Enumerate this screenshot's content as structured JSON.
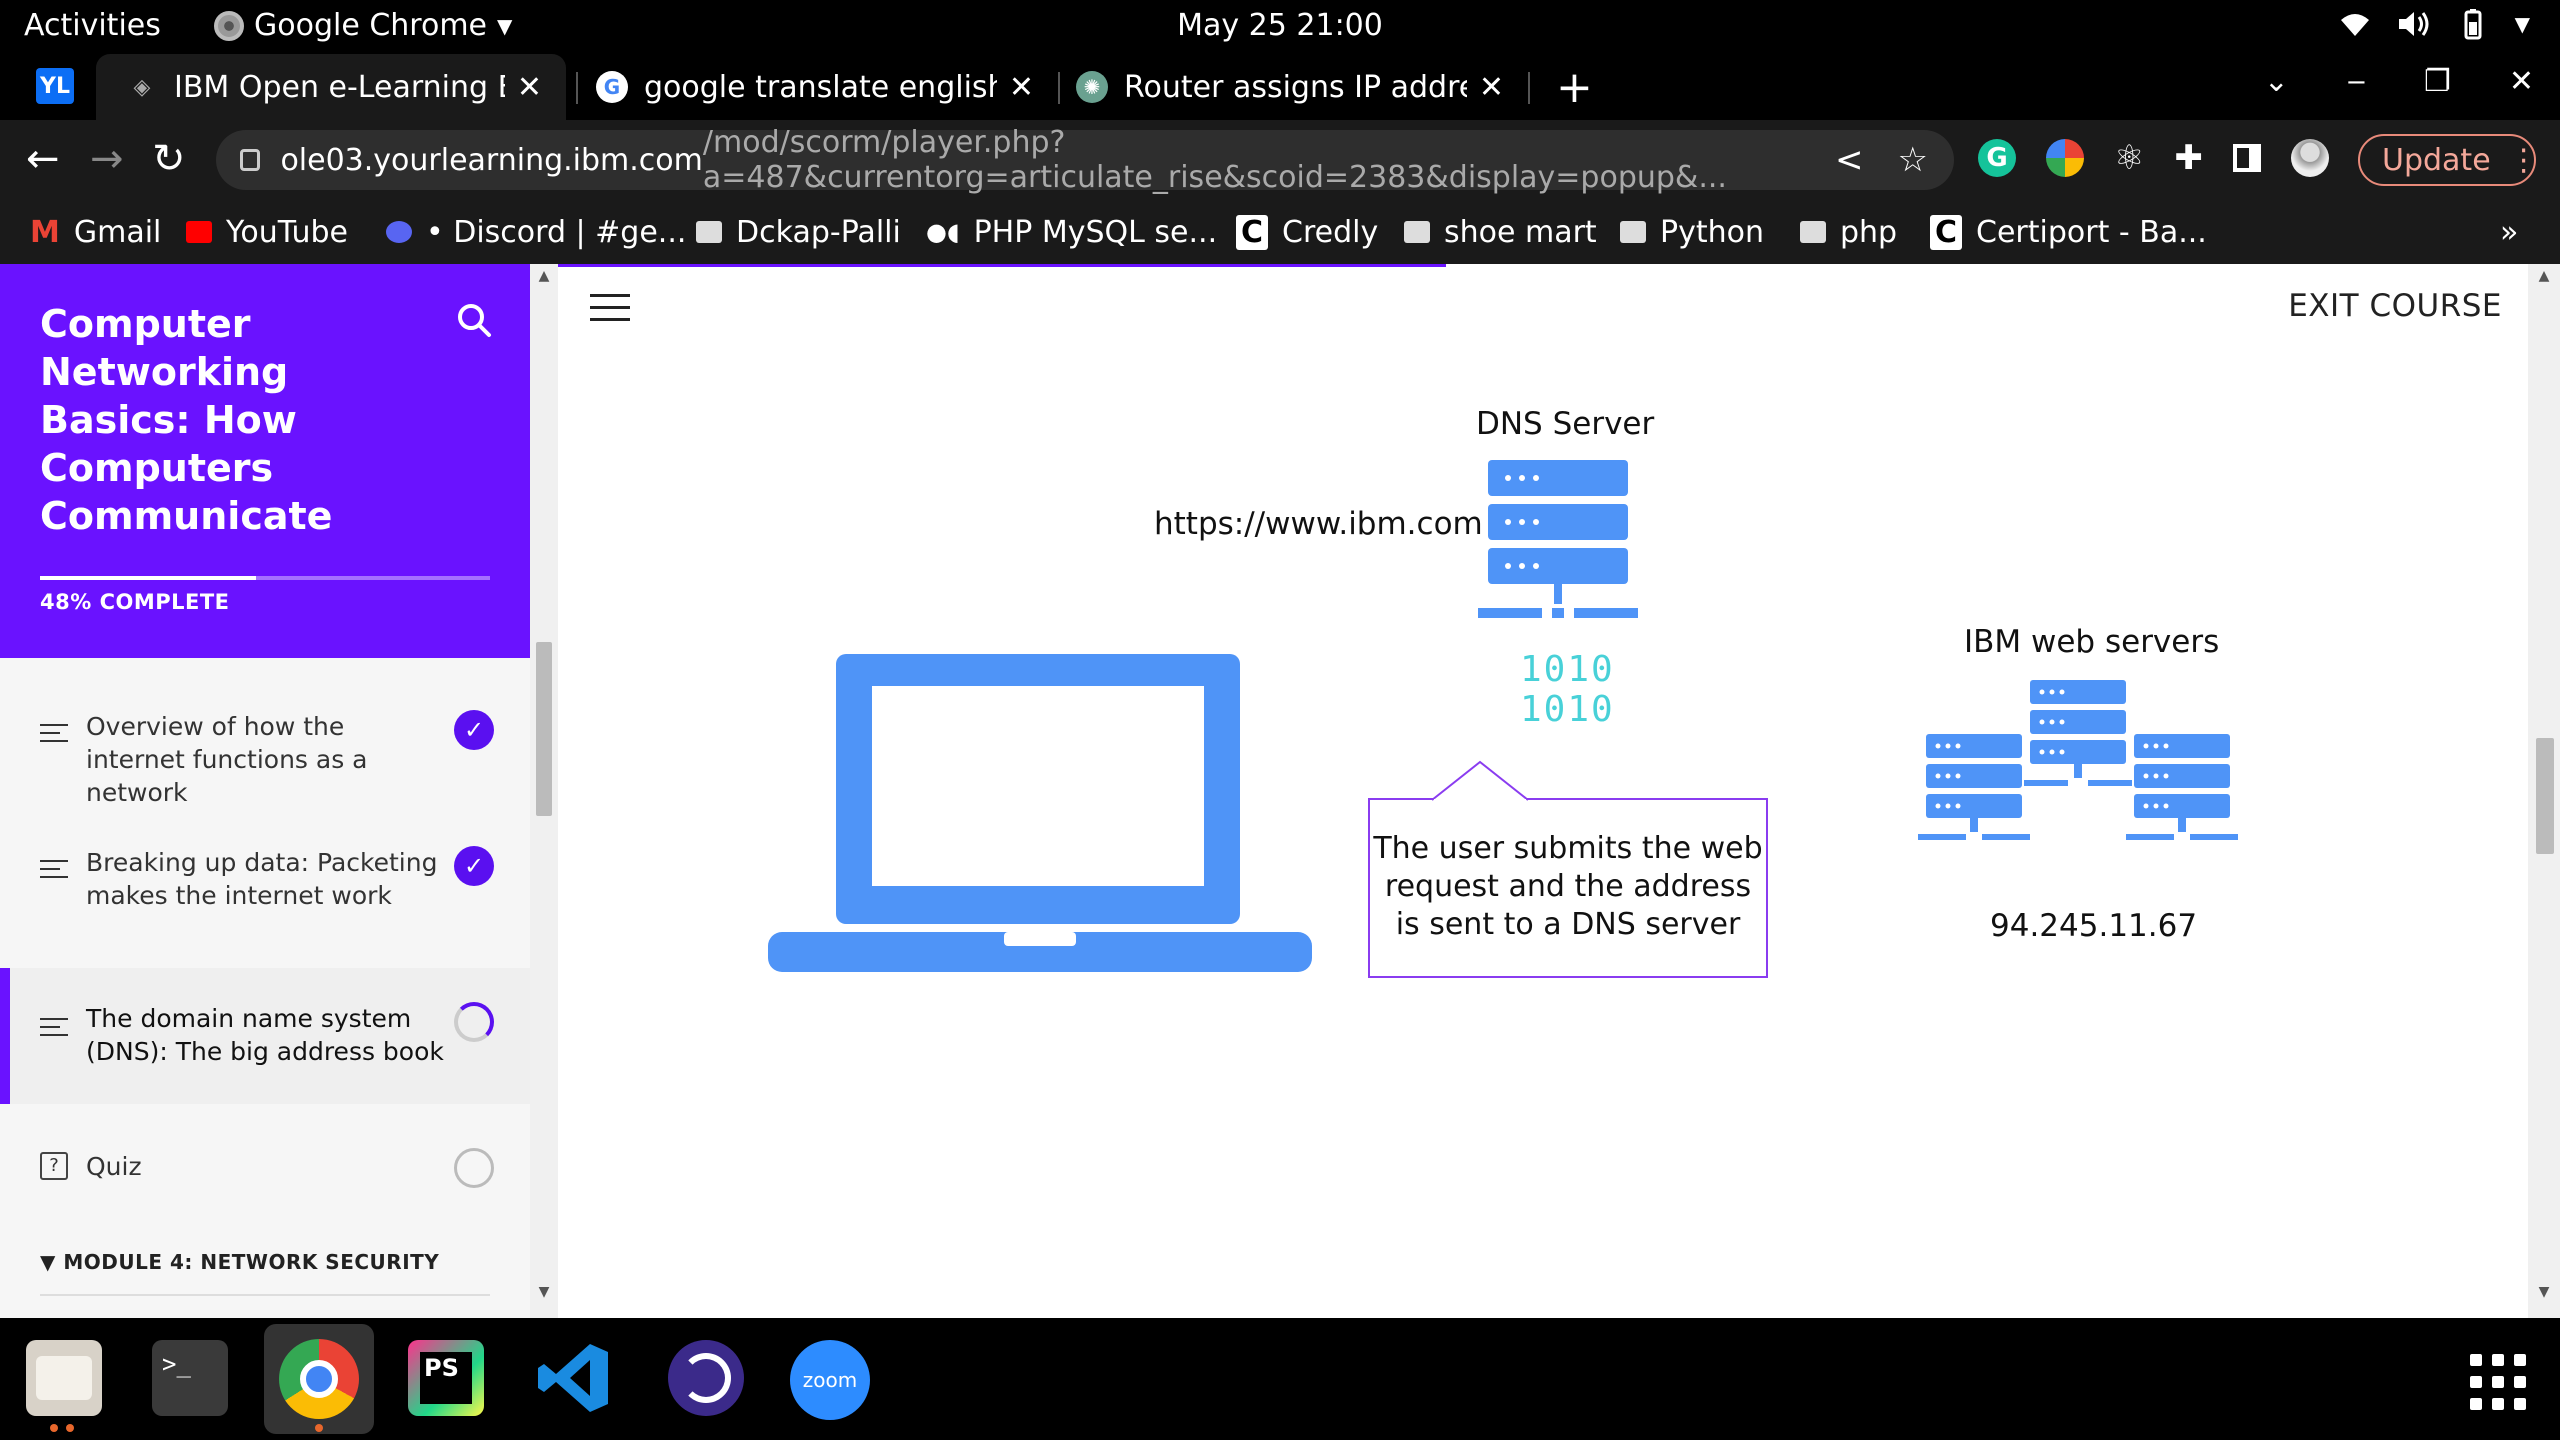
{
  "topbar": {
    "activities": "Activities",
    "app_name": "Google Chrome",
    "clock": "May 25  21:00"
  },
  "tabs": [
    {
      "title": "IBM Open e-Learning Ecos",
      "active": true
    },
    {
      "title": "google translate english t",
      "active": false
    },
    {
      "title": "Router assigns IP address",
      "active": false
    }
  ],
  "address": {
    "host": "ole03.yourlearning.ibm.com",
    "path": "/mod/scorm/player.php?a=487&currentorg=articulate_rise&scoid=2383&display=popup&..."
  },
  "update_label": "Update",
  "bookmarks": [
    {
      "label": "Gmail",
      "icon": "gmail-icon"
    },
    {
      "label": "YouTube",
      "icon": "youtube-icon"
    },
    {
      "label": "• Discord | #ge...",
      "icon": "discord-icon"
    },
    {
      "label": "Dckap-Palli",
      "icon": "folder-icon"
    },
    {
      "label": "PHP MySQL se...",
      "icon": "medium-icon"
    },
    {
      "label": "Credly",
      "icon": "credly-icon"
    },
    {
      "label": "shoe mart",
      "icon": "folder-icon"
    },
    {
      "label": "Python",
      "icon": "folder-icon"
    },
    {
      "label": "php",
      "icon": "folder-icon"
    },
    {
      "label": "Certiport - Ba...",
      "icon": "certiport-icon"
    }
  ],
  "bookmarks_more": "»",
  "course": {
    "title": "Computer Networking Basics: How Computers Communicate",
    "progress_percent": 48,
    "progress_label": "48% COMPLETE",
    "lessons": [
      {
        "title": "Overview of how the internet functions as a network",
        "status": "complete"
      },
      {
        "title": "Breaking up data: Packeting makes the internet work",
        "status": "complete"
      },
      {
        "title": "The domain name system (DNS): The big address book",
        "status": "in-progress"
      },
      {
        "title": "Quiz",
        "status": "not-started"
      }
    ],
    "next_module": "MODULE 4: NETWORK SECURITY"
  },
  "lesson_content": {
    "exit_label": "EXIT COURSE",
    "diagram": {
      "dns_server_label": "DNS Server",
      "url": "https://www.ibm.com",
      "binary_lines": [
        "1010",
        "1010"
      ],
      "callout": "The user submits the web request and the address is sent to a DNS server",
      "web_servers_label": "IBM web servers",
      "ip_address": "94.245.11.67"
    }
  },
  "colors": {
    "brand_purple": "#6a12ff",
    "diagram_blue": "#4f94f7",
    "binary_teal": "#48d1d8",
    "callout_border": "#8a3cf0"
  },
  "dock": [
    "files-icon",
    "terminal-icon",
    "chrome-icon",
    "phpstorm-icon",
    "vscode-icon",
    "obs-icon",
    "zoom-icon"
  ],
  "dock_zoom_label": "zoom",
  "dock_ps_label": "PS"
}
